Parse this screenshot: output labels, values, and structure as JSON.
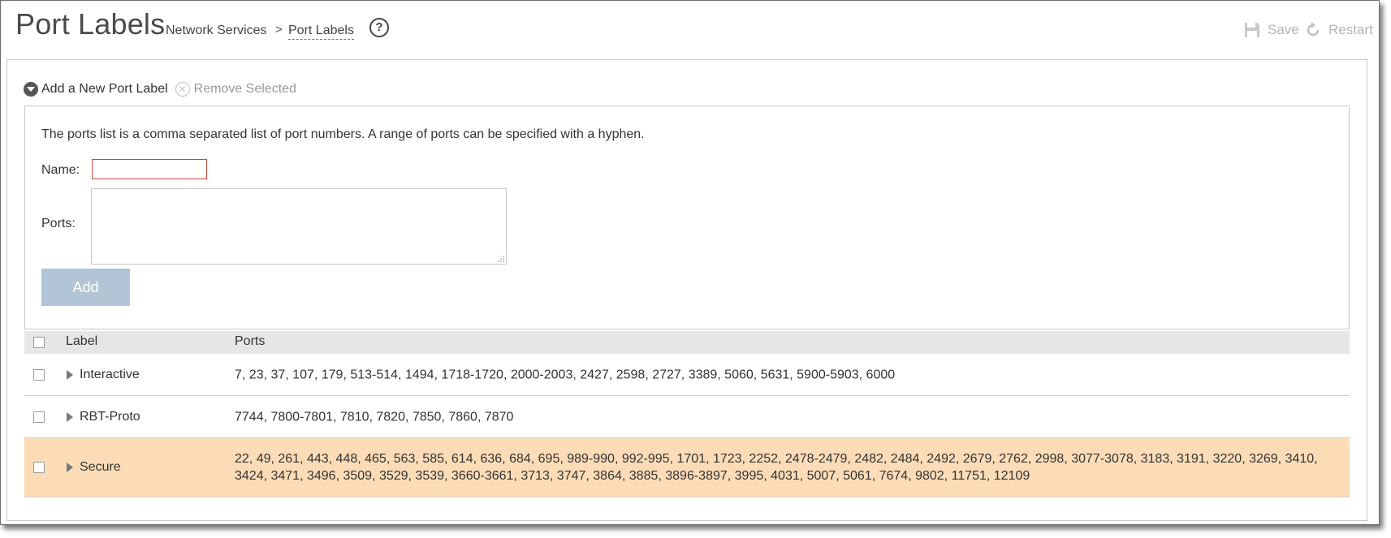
{
  "header": {
    "title": "Port Labels",
    "breadcrumb": [
      "Network Services",
      "Port Labels"
    ],
    "breadcrumb_separator": ">",
    "help_icon": "question-circle-icon",
    "save_label": "Save",
    "restart_label": "Restart",
    "disabled_color": "#b4b4b4"
  },
  "toolbar": {
    "add_label": "Add a New Port Label",
    "remove_label": "Remove Selected"
  },
  "form": {
    "description": "The ports list is a comma separated list of port numbers.  A range of ports can be specified with a hyphen.",
    "name_label": "Name:",
    "name_value": "",
    "ports_label": "Ports:",
    "ports_value": "",
    "add_button": "Add",
    "add_button_color": "#b1c5d6",
    "error_border_color": "#d0433a"
  },
  "table": {
    "columns": [
      "Label",
      "Ports"
    ],
    "rows": [
      {
        "label": "Interactive",
        "ports": "7, 23, 37, 107, 179, 513-514, 1494, 1718-1720, 2000-2003, 2427, 2598, 2727, 3389, 5060, 5631, 5900-5903, 6000",
        "selected": false
      },
      {
        "label": "RBT-Proto",
        "ports": "7744, 7800-7801, 7810, 7820, 7850, 7860, 7870",
        "selected": false
      },
      {
        "label": "Secure",
        "ports": "22, 49, 261, 443, 448, 465, 563, 585, 614, 636, 684, 695, 989-990, 992-995, 1701, 1723, 2252, 2478-2479, 2482, 2484, 2492, 2679, 2762, 2998, 3077-3078, 3183, 3191, 3220, 3269, 3410, 3424, 3471, 3496, 3509, 3529, 3539, 3660-3661, 3713, 3747, 3864, 3885, 3896-3897, 3995, 4031, 5007, 5061, 7674, 9802, 11751, 12109",
        "highlighted": true,
        "highlight_color": "#fbdcb6"
      }
    ]
  }
}
